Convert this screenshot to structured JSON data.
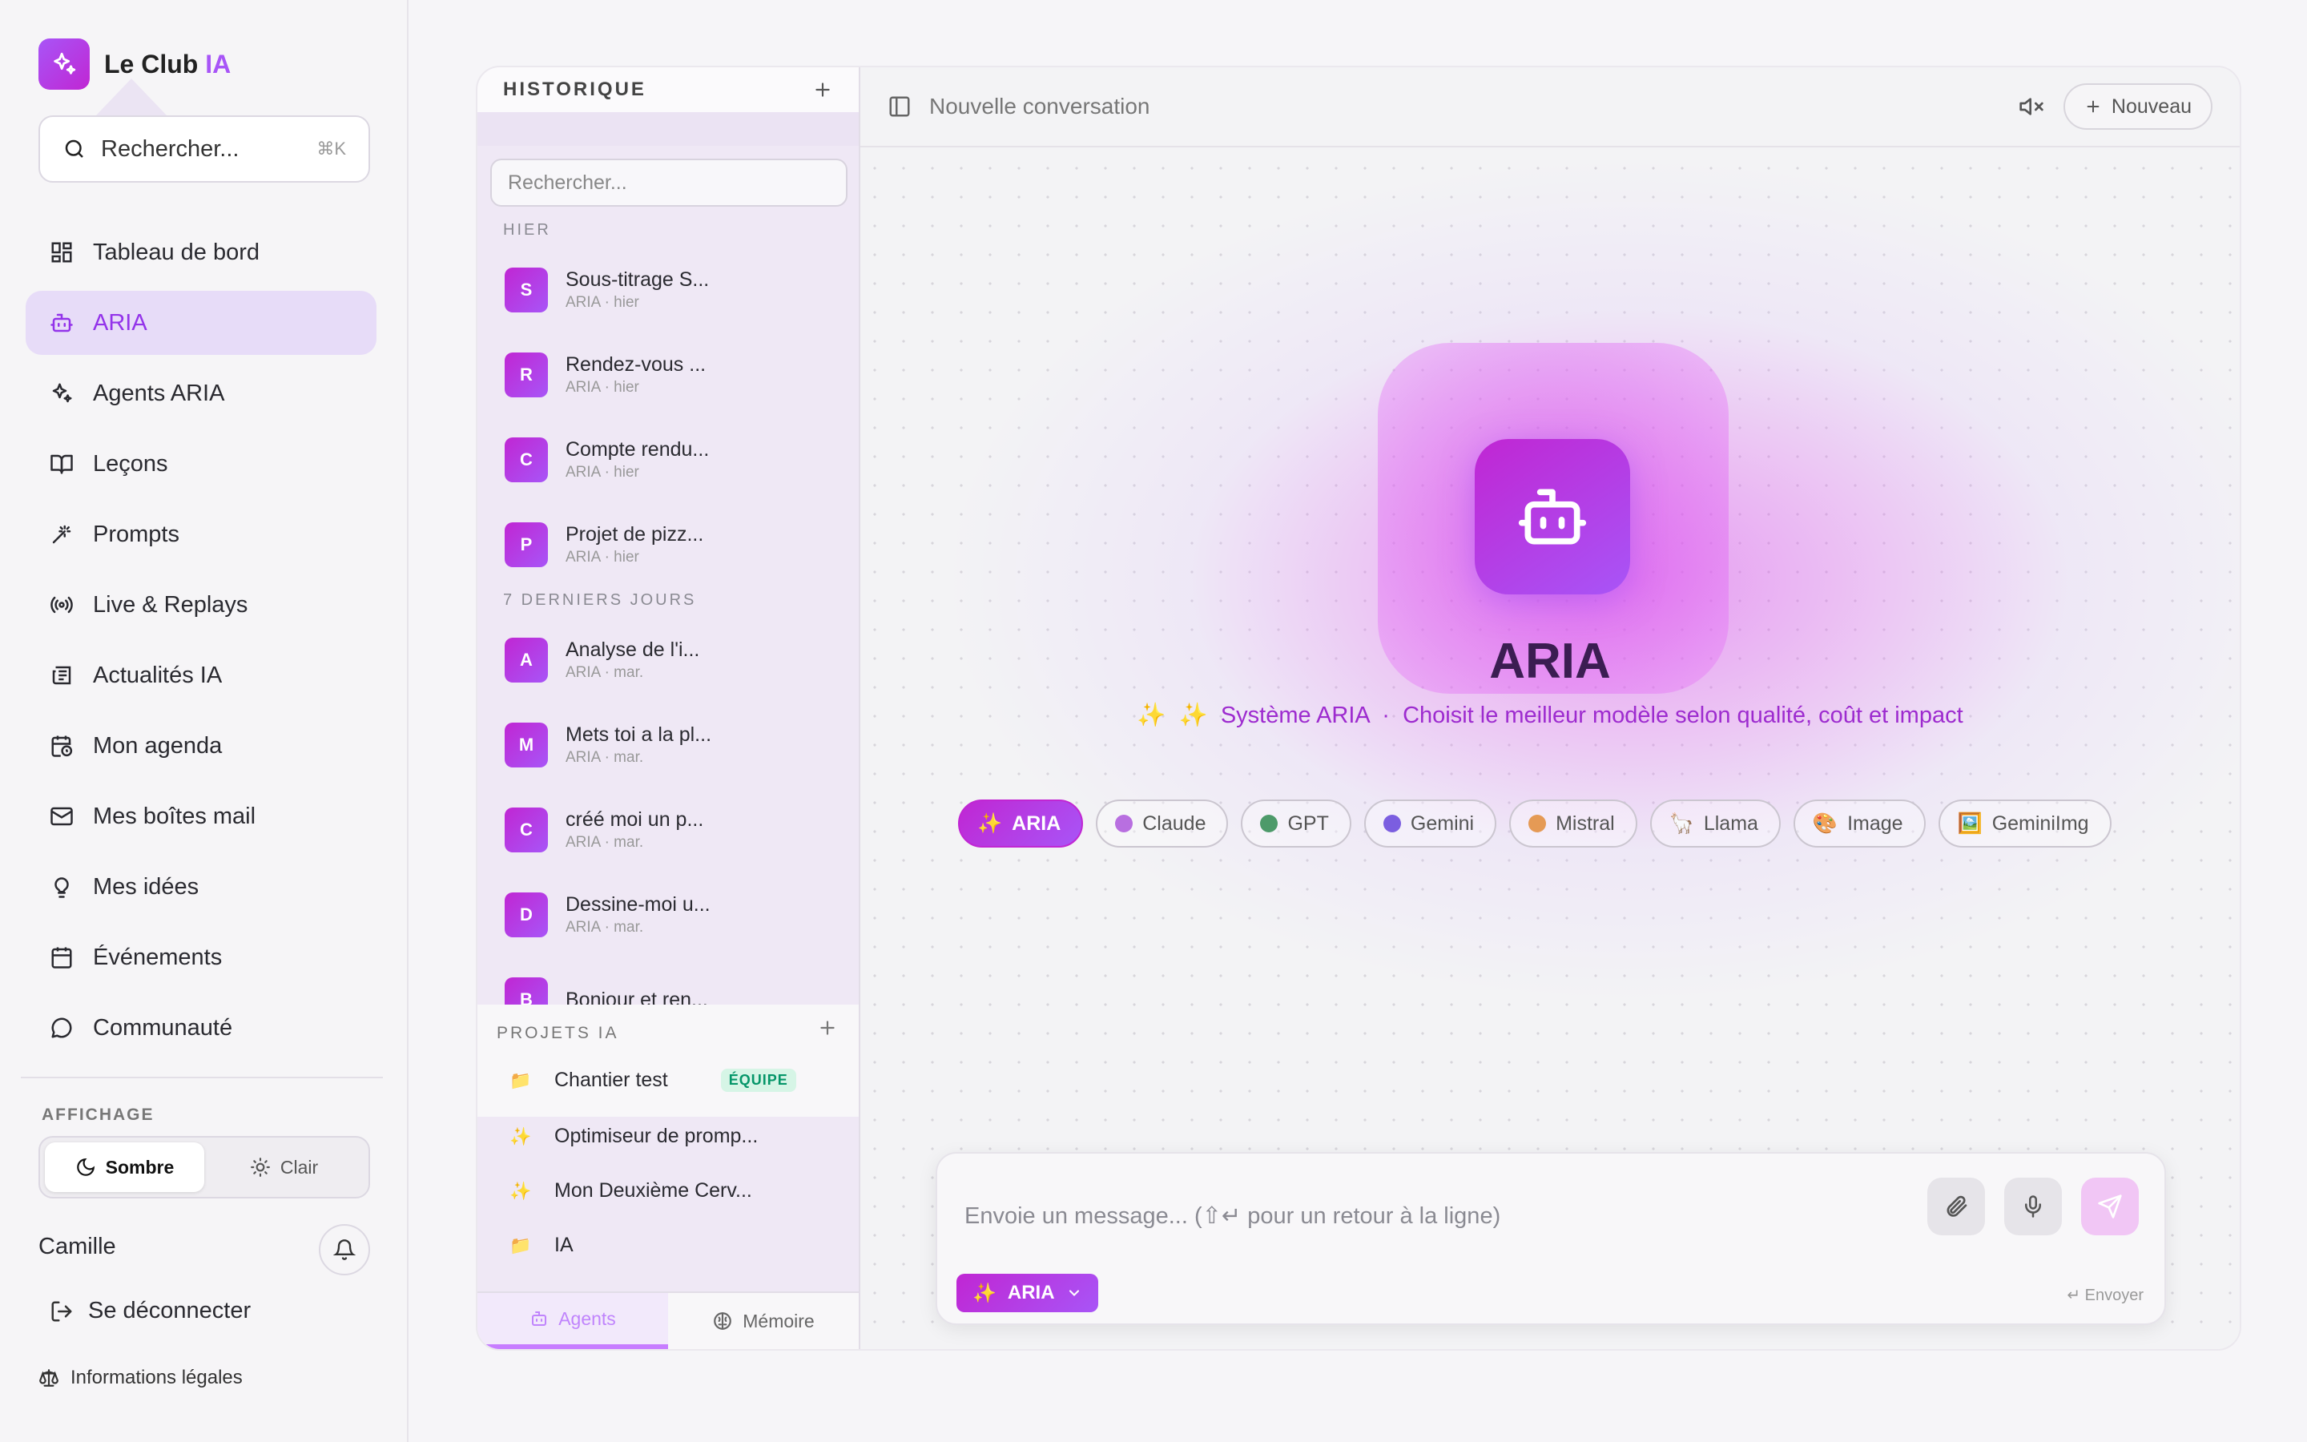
{
  "brand": {
    "name": "Le Club ",
    "accent": "IA"
  },
  "search": {
    "placeholder": "Rechercher...",
    "shortcut": "⌘K"
  },
  "nav": [
    {
      "label": "Tableau de bord",
      "icon": "dashboard-icon"
    },
    {
      "label": "ARIA",
      "icon": "bot-icon",
      "active": true
    },
    {
      "label": "Agents ARIA",
      "icon": "sparkles-icon"
    },
    {
      "label": "Leçons",
      "icon": "book-icon"
    },
    {
      "label": "Prompts",
      "icon": "wand-icon"
    },
    {
      "label": "Live & Replays",
      "icon": "broadcast-icon"
    },
    {
      "label": "Actualités IA",
      "icon": "newspaper-icon"
    },
    {
      "label": "Mon agenda",
      "icon": "calendar-clock-icon"
    },
    {
      "label": "Mes boîtes mail",
      "icon": "mail-icon"
    },
    {
      "label": "Mes idées",
      "icon": "lightbulb-icon"
    },
    {
      "label": "Événements",
      "icon": "calendar-icon"
    },
    {
      "label": "Communauté",
      "icon": "chat-bubble-icon"
    }
  ],
  "display": {
    "label": "AFFICHAGE",
    "dark": "Sombre",
    "light": "Clair"
  },
  "user": {
    "name": "Camille",
    "logout": "Se déconnecter",
    "legal": "Informations légales"
  },
  "history": {
    "title": "HISTORIQUE",
    "search_placeholder": "Rechercher...",
    "groups": [
      {
        "label": "HIER",
        "items": [
          {
            "initial": "S",
            "title": "Sous-titrage S...",
            "meta": "ARIA · hier"
          },
          {
            "initial": "R",
            "title": "Rendez-vous ...",
            "meta": "ARIA · hier"
          },
          {
            "initial": "C",
            "title": "Compte rendu...",
            "meta": "ARIA · hier"
          },
          {
            "initial": "P",
            "title": "Projet de pizz...",
            "meta": "ARIA · hier"
          }
        ]
      },
      {
        "label": "7 DERNIERS JOURS",
        "items": [
          {
            "initial": "A",
            "title": "Analyse de l'i...",
            "meta": "ARIA · mar."
          },
          {
            "initial": "M",
            "title": "Mets toi a la pl...",
            "meta": "ARIA · mar."
          },
          {
            "initial": "C",
            "title": "créé moi un p...",
            "meta": "ARIA · mar."
          },
          {
            "initial": "D",
            "title": "Dessine-moi u...",
            "meta": "ARIA · mar."
          },
          {
            "initial": "B",
            "title": "Bonjour et ren...",
            "meta": ""
          }
        ]
      }
    ]
  },
  "projects": {
    "title": "PROJETS IA",
    "items": [
      {
        "icon": "📁",
        "label": "Chantier test",
        "badge": "ÉQUIPE"
      },
      {
        "icon": "✨",
        "label": "Optimiseur de promp..."
      },
      {
        "icon": "✨",
        "label": "Mon Deuxième Cerv..."
      },
      {
        "icon": "📁",
        "label": "IA"
      }
    ]
  },
  "panel_tabs": {
    "agents": "Agents",
    "memory": "Mémoire"
  },
  "chat": {
    "title": "Nouvelle conversation",
    "new_label": "Nouveau",
    "hero_title": "ARIA",
    "tagline_system": "Système ARIA",
    "tagline_desc": "Choisit le meilleur modèle selon qualité, coût et impact",
    "models": [
      {
        "label": "ARIA",
        "icon": "✨",
        "active": true
      },
      {
        "label": "Claude",
        "dot": "#b86fe0"
      },
      {
        "label": "GPT",
        "dot": "#4d9a6a"
      },
      {
        "label": "Gemini",
        "dot": "#7b5ee0"
      },
      {
        "label": "Mistral",
        "dot": "#e59a55"
      },
      {
        "label": "Llama",
        "icon": "🦙"
      },
      {
        "label": "Image",
        "icon": "🎨"
      },
      {
        "label": "GeminiImg",
        "icon": "🖼️"
      }
    ],
    "composer_placeholder": "Envoie un message...  (⇧↵ pour un retour à la ligne)",
    "selected_model": "ARIA",
    "send_hint": "↵ Envoyer"
  },
  "colors": {
    "accent": "#a855f7",
    "accent_deep": "#c026d3",
    "team_badge": "#059669"
  }
}
